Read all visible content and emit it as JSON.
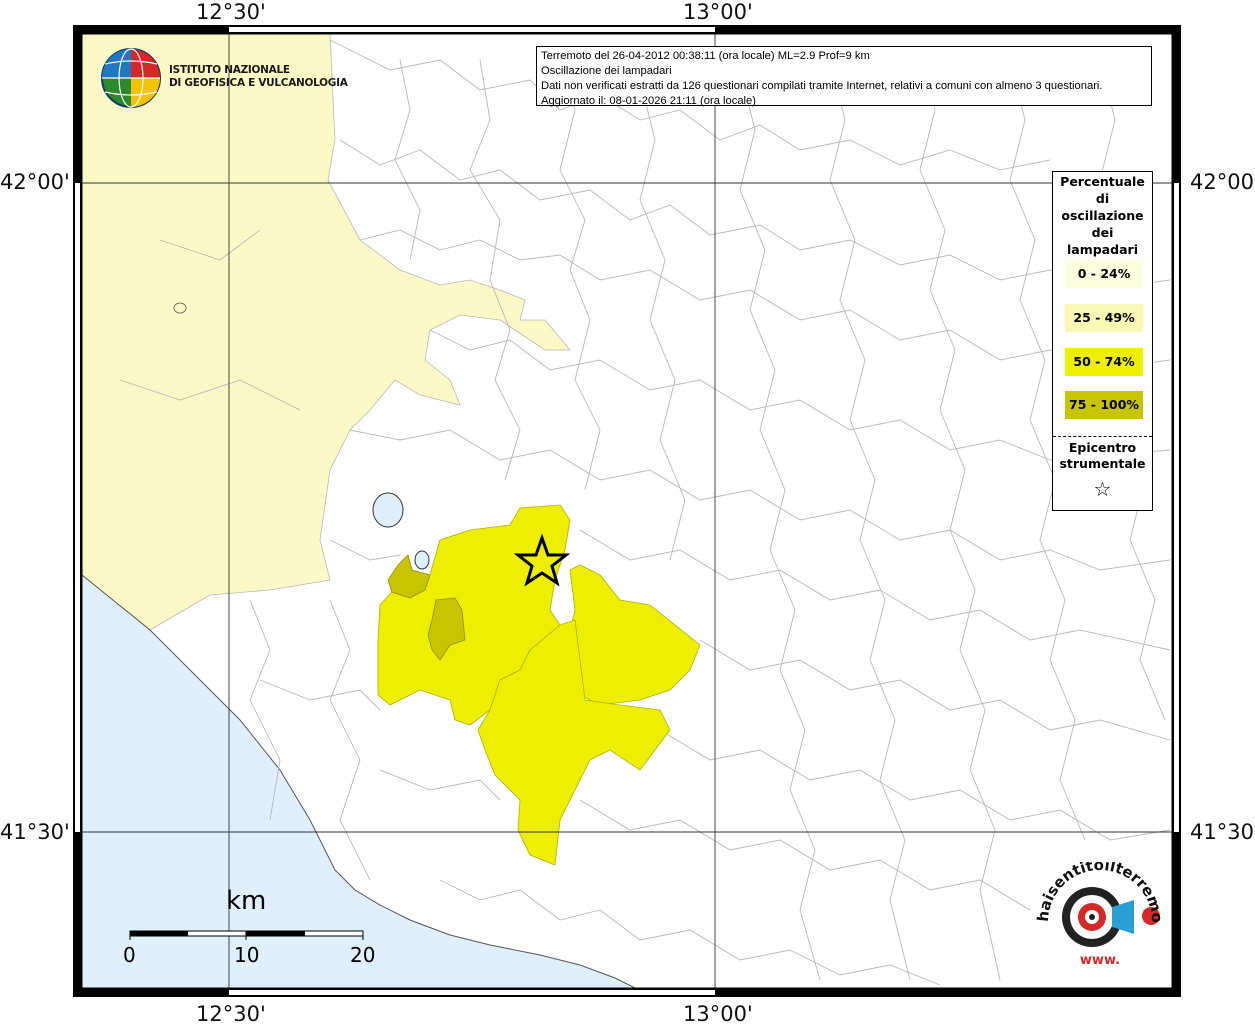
{
  "map": {
    "frame_coords": {
      "top_left_lon": "12°30'",
      "top_right_lon": "13°00'",
      "bottom_left_lon": "12°30'",
      "bottom_right_lon": "13°00'",
      "left_upper_lat": "42°00'",
      "left_lower_lat": "41°30'",
      "right_upper_lat": "42°00'",
      "right_lower_lat": "41°30'"
    },
    "colors": {
      "sea": "#dff0fc",
      "land": "#ffffff",
      "region_light": "#fdf9c6",
      "class_0_24": "#fdfde0",
      "class_25_49": "#fbf7b4",
      "class_50_74": "#eeee00",
      "class_75_100": "#c9c400"
    }
  },
  "info": {
    "line1": "Terremoto del 26-04-2012 00:38:11 (ora locale) ML=2.9 Prof=9 km",
    "line2": "Oscillazione dei lampadari",
    "line3": "Dati non verificati estratti da 126 questionari compilati tramite Internet, relativi a comuni con almeno 3 questionari.",
    "line4": "Aggiornato il: 08-01-2026 21:11 (ora locale)"
  },
  "logo": {
    "line1": "ISTITUTO NAZIONALE",
    "line2": "DI GEOFISICA E VULCANOLOGIA",
    "icon": "globe-icon"
  },
  "legend": {
    "title_lines": [
      "Percentuale",
      "di",
      "oscillazione",
      "dei",
      "lampadari"
    ],
    "items": [
      {
        "label": "0 - 24%",
        "color": "#fdfde0"
      },
      {
        "label": "25 - 49%",
        "color": "#fbf7b4"
      },
      {
        "label": "50 - 74%",
        "color": "#eeee00"
      },
      {
        "label": "75 - 100%",
        "color": "#c9c400"
      }
    ],
    "epicenter_line1": "Epicentro",
    "epicenter_line2": "strumentale",
    "epicenter_icon": "star-icon"
  },
  "scale": {
    "unit": "km",
    "ticks": [
      "0",
      "10",
      "20"
    ]
  },
  "badge": {
    "text": "haisentitoilterremoto.it",
    "www": "www.",
    "icon": "seismometer-icon"
  }
}
